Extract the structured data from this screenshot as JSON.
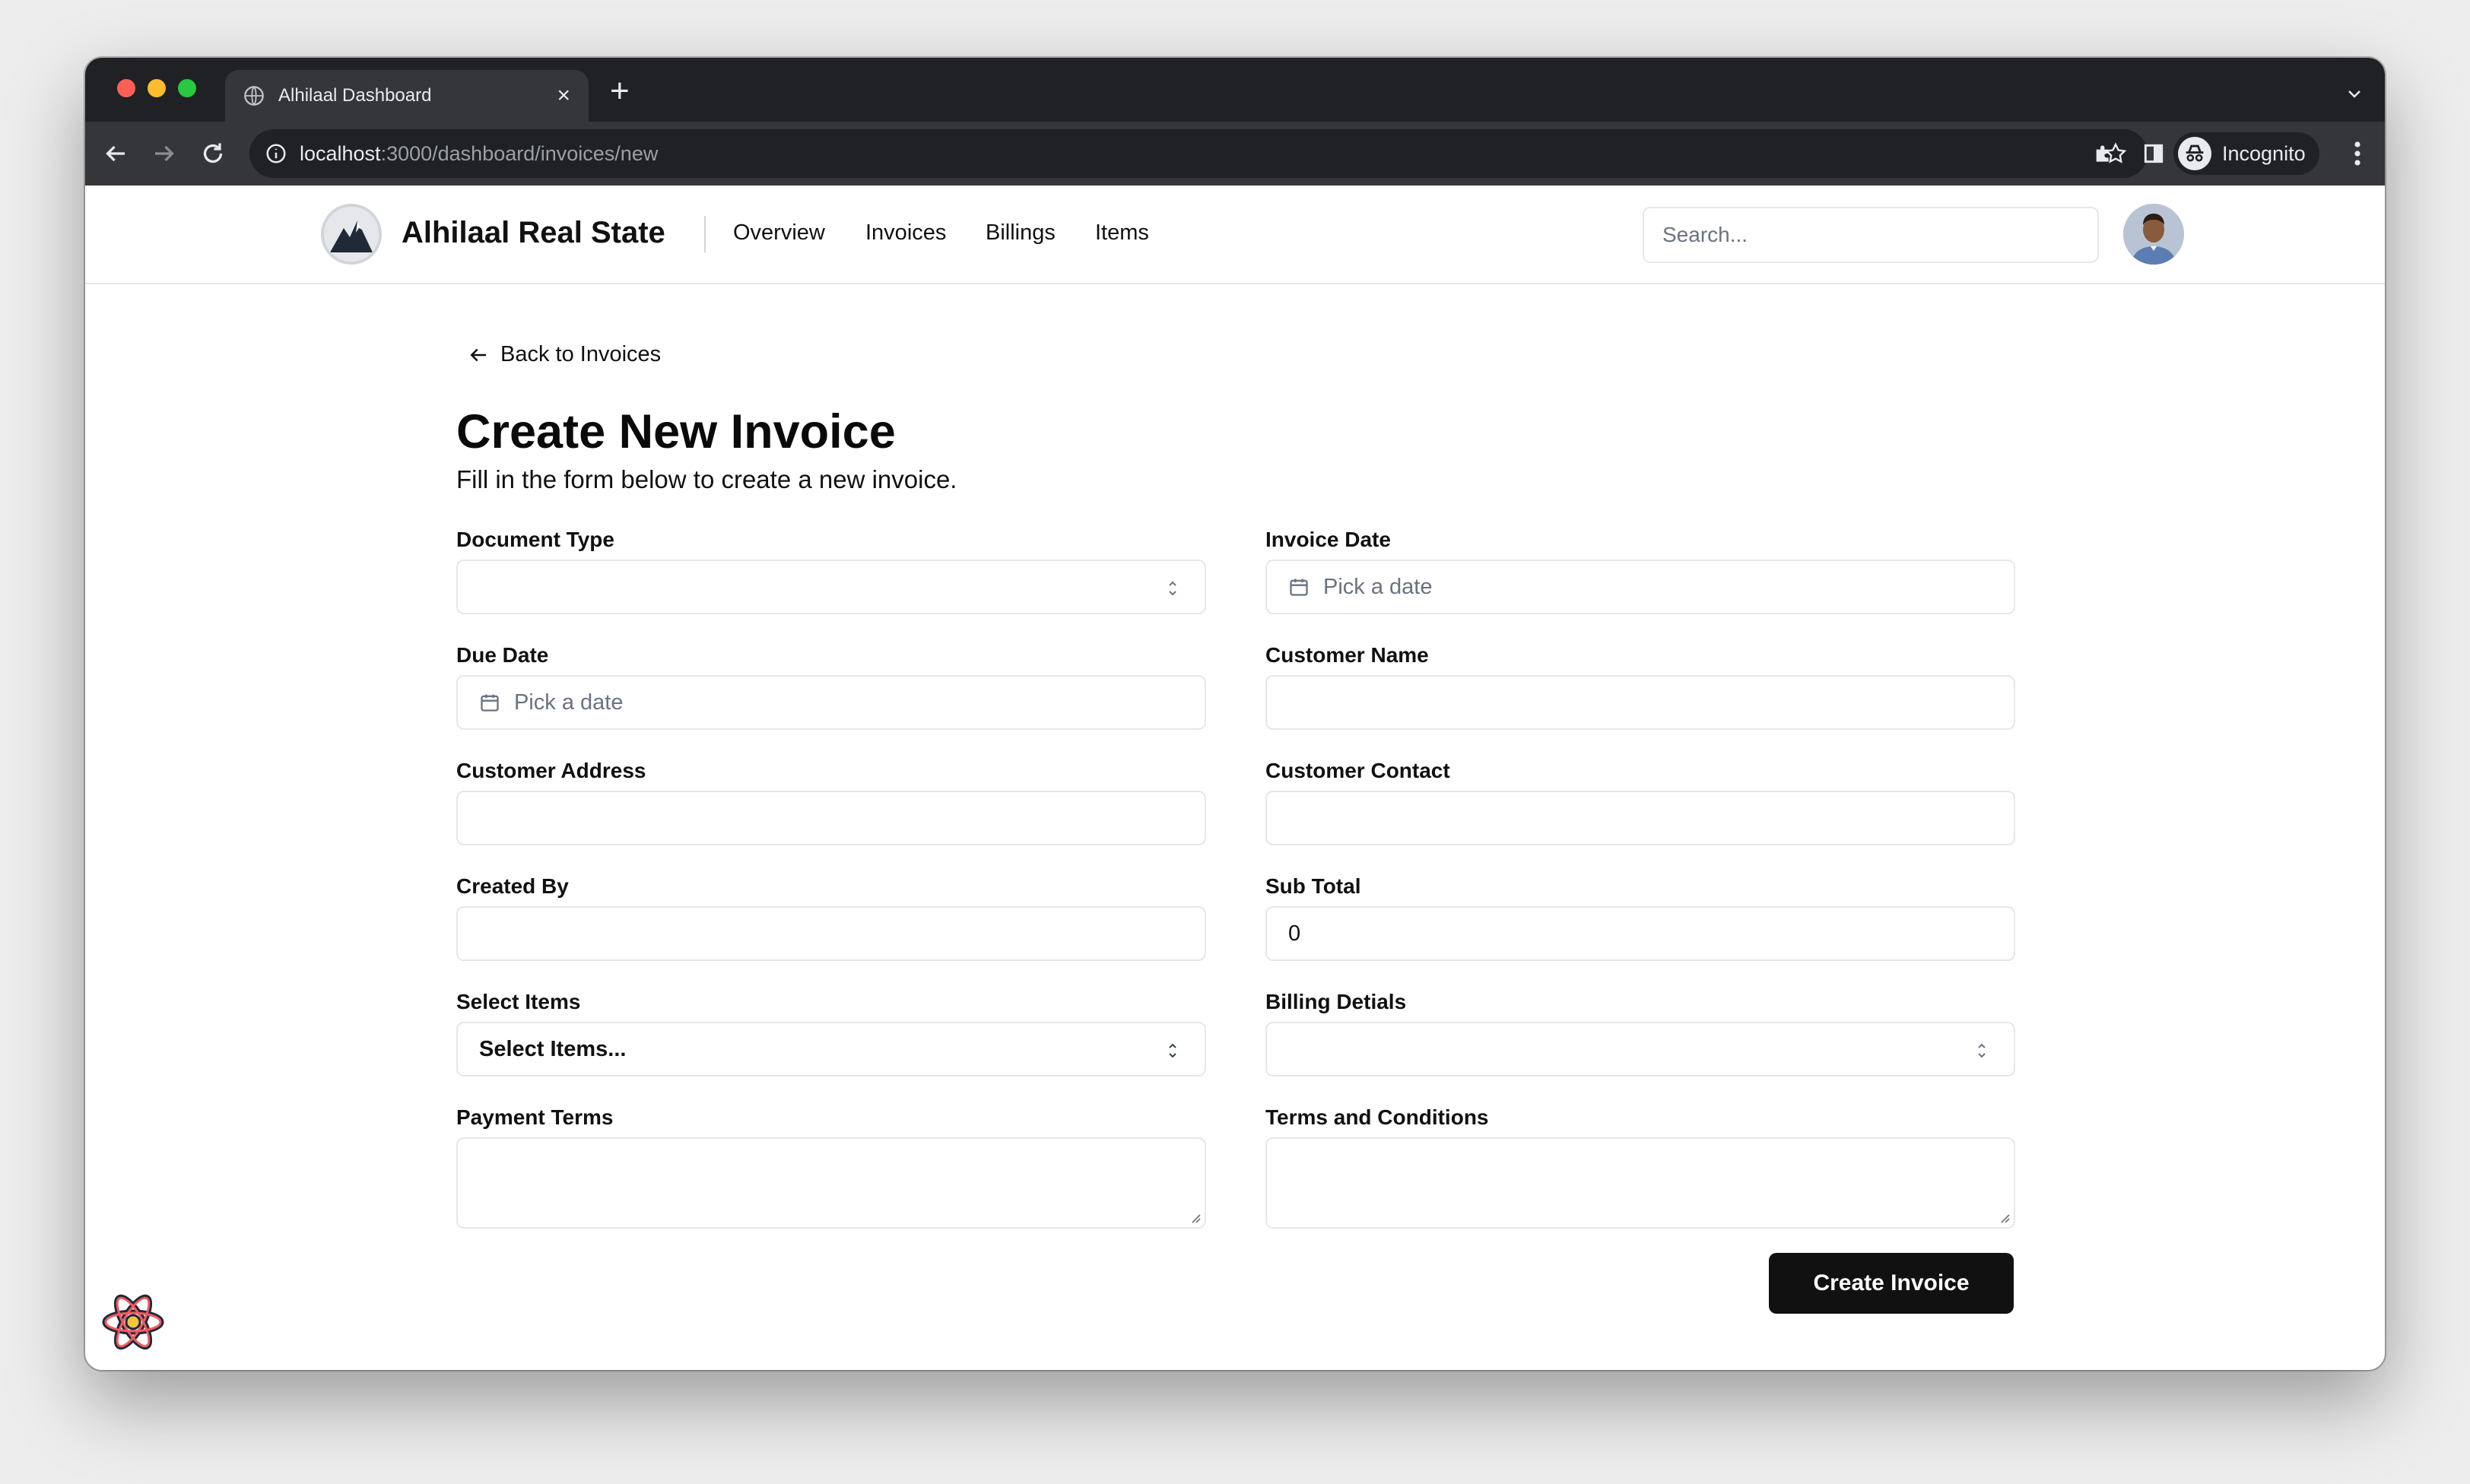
{
  "browser": {
    "tab_title": "Alhilaal Dashboard",
    "url_host": "localhost",
    "url_rest": ":3000/dashboard/invoices/new",
    "incognito_label": "Incognito"
  },
  "header": {
    "brand": "Alhilaal Real State",
    "nav": [
      "Overview",
      "Invoices",
      "Billings",
      "Items"
    ],
    "search_placeholder": "Search..."
  },
  "page": {
    "back_label": "Back to Invoices",
    "title": "Create New Invoice",
    "subtitle": "Fill in the form below to create a new invoice."
  },
  "form": {
    "document_type": {
      "label": "Document Type",
      "value": ""
    },
    "invoice_date": {
      "label": "Invoice Date",
      "placeholder": "Pick a date"
    },
    "due_date": {
      "label": "Due Date",
      "placeholder": "Pick a date"
    },
    "customer_name": {
      "label": "Customer Name",
      "value": ""
    },
    "customer_address": {
      "label": "Customer Address",
      "value": ""
    },
    "customer_contact": {
      "label": "Customer Contact",
      "value": ""
    },
    "created_by": {
      "label": "Created By",
      "value": ""
    },
    "sub_total": {
      "label": "Sub Total",
      "value": "0"
    },
    "select_items": {
      "label": "Select Items",
      "value": "Select Items..."
    },
    "billing_details": {
      "label": "Billing Detials",
      "value": ""
    },
    "payment_terms": {
      "label": "Payment Terms",
      "value": ""
    },
    "terms_conditions": {
      "label": "Terms and Conditions",
      "value": ""
    },
    "submit_label": "Create Invoice"
  },
  "colors": {
    "primary_button": "#111111",
    "border": "#e5e7eb",
    "browser_chrome": "#202124"
  }
}
